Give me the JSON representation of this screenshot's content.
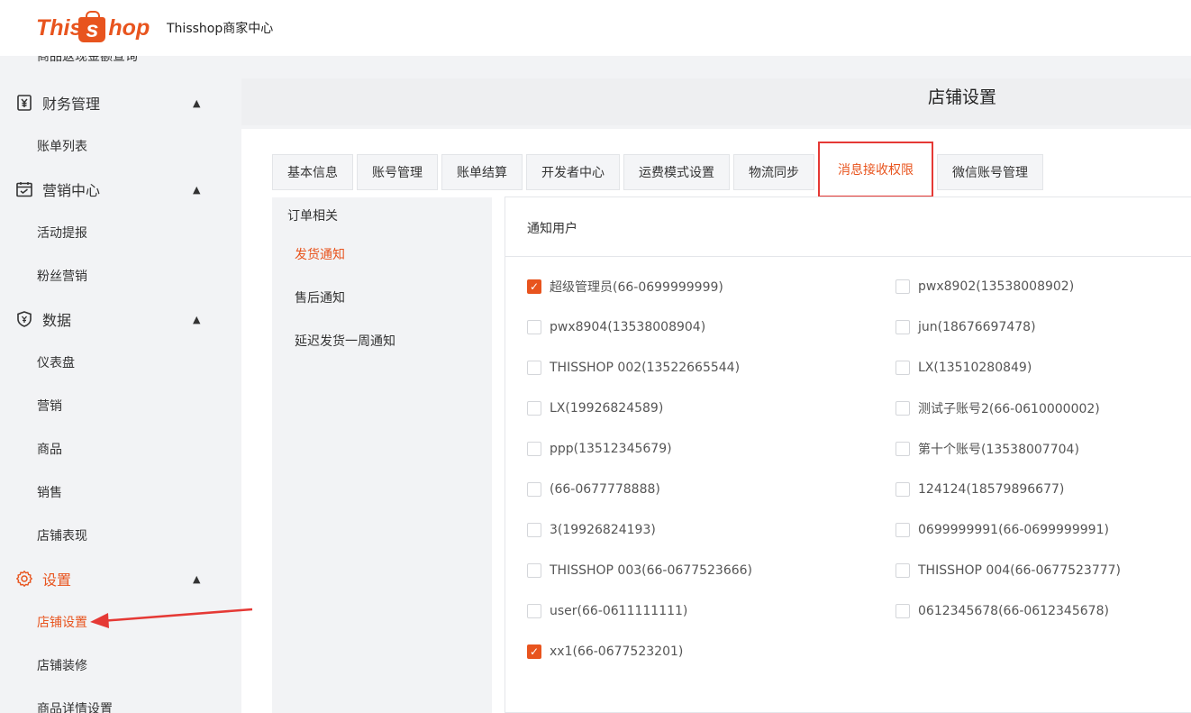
{
  "header": {
    "logo_this": "This",
    "logo_s": "s",
    "logo_hop": "hop",
    "title": "Thisshop商家中心"
  },
  "sidebar": {
    "cut_item": "商品返现金额查询",
    "groups": [
      {
        "label": "财务管理",
        "icon": "finance-icon",
        "subs": [
          "账单列表"
        ]
      },
      {
        "label": "营销中心",
        "icon": "marketing-icon",
        "subs": [
          "活动提报",
          "粉丝营销"
        ]
      },
      {
        "label": "数据",
        "icon": "data-icon",
        "subs": [
          "仪表盘",
          "营销",
          "商品",
          "销售",
          "店铺表现"
        ]
      },
      {
        "label": "设置",
        "icon": "gear-icon",
        "subs": [
          "店铺设置",
          "店铺装修",
          "商品详情设置"
        ]
      }
    ],
    "active_group": "设置",
    "active_sub": "店铺设置",
    "accent": "#e8541e"
  },
  "page": {
    "title": "店铺设置"
  },
  "tabs": [
    "基本信息",
    "账号管理",
    "账单结算",
    "开发者中心",
    "运费模式设置",
    "物流同步",
    "消息接收权限",
    "微信账号管理"
  ],
  "active_tab": "消息接收权限",
  "subnav": {
    "category": "订单相关",
    "items": [
      "发货通知",
      "售后通知",
      "延迟发货一周通知"
    ],
    "active": "发货通知"
  },
  "panel": {
    "header": "通知用户",
    "users_left": [
      {
        "name": "超级管理员(66-0699999999)",
        "checked": true
      },
      {
        "name": "pwx8904(13538008904)",
        "checked": false
      },
      {
        "name": "THISSHOP 002(13522665544)",
        "checked": false
      },
      {
        "name": "LX(19926824589)",
        "checked": false
      },
      {
        "name": "ppp(13512345679)",
        "checked": false
      },
      {
        "name": "(66-0677778888)",
        "checked": false
      },
      {
        "name": "3(19926824193)",
        "checked": false
      },
      {
        "name": "THISSHOP 003(66-0677523666)",
        "checked": false
      },
      {
        "name": "user(66-0611111111)",
        "checked": false
      },
      {
        "name": "xx1(66-0677523201)",
        "checked": true
      }
    ],
    "users_right": [
      {
        "name": "pwx8902(13538008902)",
        "checked": false
      },
      {
        "name": "jun(18676697478)",
        "checked": false
      },
      {
        "name": "LX(13510280849)",
        "checked": false
      },
      {
        "name": "测试子账号2(66-0610000002)",
        "checked": false
      },
      {
        "name": "第十个账号(13538007704)",
        "checked": false
      },
      {
        "name": "124124(18579896677)",
        "checked": false
      },
      {
        "name": "0699999991(66-0699999991)",
        "checked": false
      },
      {
        "name": "THISSHOP 004(66-0677523777)",
        "checked": false
      },
      {
        "name": "0612345678(66-0612345678)",
        "checked": false
      }
    ]
  }
}
